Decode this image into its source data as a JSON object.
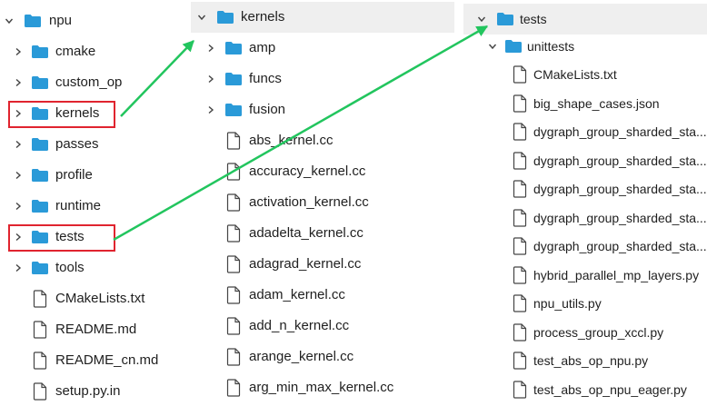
{
  "colors": {
    "folder": "#2a9ad8",
    "arrow": "#22c55e",
    "highlight_box": "#e0242f",
    "selected_row": "#efefef"
  },
  "left_tree": {
    "root": {
      "label": "npu",
      "expanded": true,
      "icon": "folder-icon"
    },
    "items": [
      {
        "label": "cmake",
        "type": "folder"
      },
      {
        "label": "custom_op",
        "type": "folder"
      },
      {
        "label": "kernels",
        "type": "folder",
        "boxed": true
      },
      {
        "label": "passes",
        "type": "folder"
      },
      {
        "label": "profile",
        "type": "folder"
      },
      {
        "label": "runtime",
        "type": "folder"
      },
      {
        "label": "tests",
        "type": "folder",
        "boxed": true
      },
      {
        "label": "tools",
        "type": "folder"
      },
      {
        "label": "CMakeLists.txt",
        "type": "file"
      },
      {
        "label": "README.md",
        "type": "file"
      },
      {
        "label": "README_cn.md",
        "type": "file"
      },
      {
        "label": "setup.py.in",
        "type": "file"
      }
    ]
  },
  "middle_tree": {
    "root": {
      "label": "kernels",
      "expanded": true,
      "icon": "folder-icon"
    },
    "items": [
      {
        "label": "amp",
        "type": "folder"
      },
      {
        "label": "funcs",
        "type": "folder"
      },
      {
        "label": "fusion",
        "type": "folder"
      },
      {
        "label": "abs_kernel.cc",
        "type": "file"
      },
      {
        "label": "accuracy_kernel.cc",
        "type": "file"
      },
      {
        "label": "activation_kernel.cc",
        "type": "file"
      },
      {
        "label": "adadelta_kernel.cc",
        "type": "file"
      },
      {
        "label": "adagrad_kernel.cc",
        "type": "file"
      },
      {
        "label": "adam_kernel.cc",
        "type": "file"
      },
      {
        "label": "add_n_kernel.cc",
        "type": "file"
      },
      {
        "label": "arange_kernel.cc",
        "type": "file"
      },
      {
        "label": "arg_min_max_kernel.cc",
        "type": "file"
      }
    ]
  },
  "right_tree": {
    "root": {
      "label": "tests",
      "expanded": true,
      "icon": "folder-icon"
    },
    "subfolder": {
      "label": "unittests",
      "expanded": true,
      "icon": "folder-icon"
    },
    "items": [
      {
        "label": "CMakeLists.txt",
        "type": "file"
      },
      {
        "label": "big_shape_cases.json",
        "type": "file"
      },
      {
        "label": "dygraph_group_sharded_sta...",
        "type": "file"
      },
      {
        "label": "dygraph_group_sharded_sta...",
        "type": "file"
      },
      {
        "label": "dygraph_group_sharded_sta...",
        "type": "file"
      },
      {
        "label": "dygraph_group_sharded_sta...",
        "type": "file"
      },
      {
        "label": "dygraph_group_sharded_sta...",
        "type": "file"
      },
      {
        "label": "hybrid_parallel_mp_layers.py",
        "type": "file"
      },
      {
        "label": "npu_utils.py",
        "type": "file"
      },
      {
        "label": "process_group_xccl.py",
        "type": "file"
      },
      {
        "label": "test_abs_op_npu.py",
        "type": "file"
      },
      {
        "label": "test_abs_op_npu_eager.py",
        "type": "file"
      }
    ]
  }
}
